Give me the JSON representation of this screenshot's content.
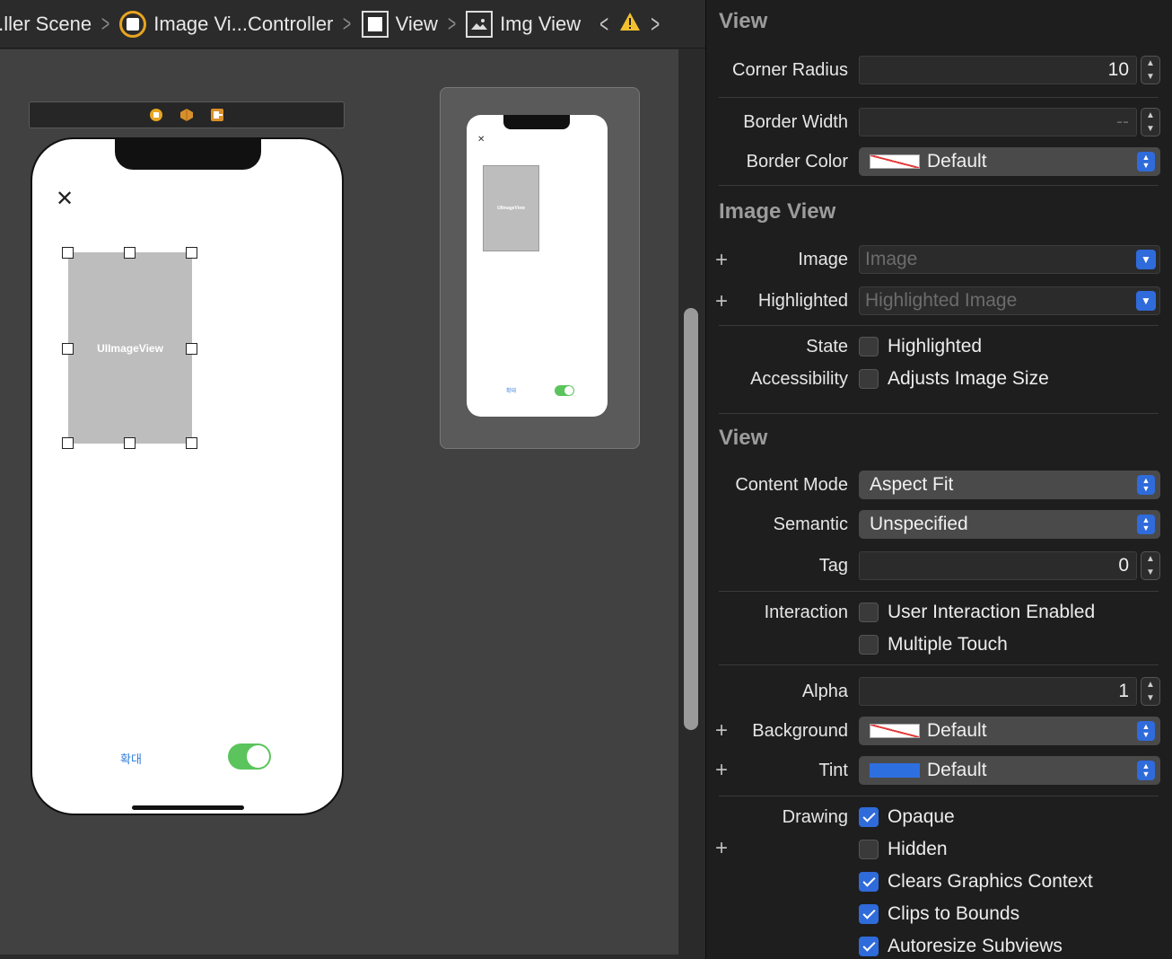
{
  "breadcrumb": {
    "scene": "..ller Scene",
    "controller": "Image Vi...Controller",
    "view": "View",
    "img_view": "Img View"
  },
  "canvas": {
    "close_glyph": "✕",
    "image_view_label": "UIImageView",
    "zoom_label": "확대",
    "toggle_on": true
  },
  "inspector": {
    "view_layer": {
      "title": "View",
      "corner_radius_label": "Corner Radius",
      "corner_radius_value": "10",
      "border_width_label": "Border Width",
      "border_width_value": "--",
      "border_color_label": "Border Color",
      "border_color_value": "Default"
    },
    "image_view": {
      "title": "Image View",
      "image_label": "Image",
      "image_placeholder": "Image",
      "highlighted_label": "Highlighted",
      "highlighted_placeholder": "Highlighted Image",
      "state_label": "State",
      "state_option": "Highlighted",
      "accessibility_label": "Accessibility",
      "accessibility_option": "Adjusts Image Size"
    },
    "view": {
      "title": "View",
      "content_mode_label": "Content Mode",
      "content_mode_value": "Aspect Fit",
      "semantic_label": "Semantic",
      "semantic_value": "Unspecified",
      "tag_label": "Tag",
      "tag_value": "0",
      "interaction_label": "Interaction",
      "user_interaction": "User Interaction Enabled",
      "multiple_touch": "Multiple Touch",
      "alpha_label": "Alpha",
      "alpha_value": "1",
      "background_label": "Background",
      "background_value": "Default",
      "tint_label": "Tint",
      "tint_value": "Default",
      "drawing_label": "Drawing",
      "opaque": "Opaque",
      "hidden": "Hidden",
      "clears_graphics": "Clears Graphics Context",
      "clips_to_bounds": "Clips to Bounds",
      "autoresize": "Autoresize Subviews"
    },
    "checkbox_states": {
      "state_highlighted": false,
      "adjusts_image_size": false,
      "user_interaction": false,
      "multiple_touch": false,
      "opaque": true,
      "hidden": false,
      "clears_graphics": true,
      "clips_to_bounds": true,
      "autoresize": true
    }
  },
  "colors": {
    "accent_blue": "#2f6bda",
    "toggle_green": "#5bc45c",
    "warning_yellow": "#f2c02f",
    "controller_orange": "#e8a420"
  }
}
